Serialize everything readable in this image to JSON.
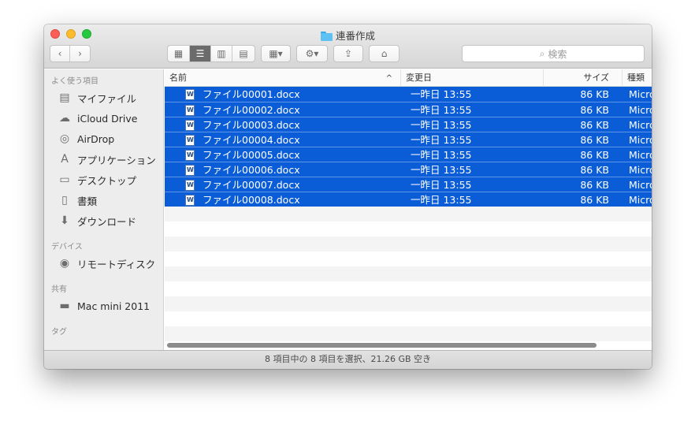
{
  "window": {
    "title": "連番作成"
  },
  "toolbar": {
    "back_icon": "‹",
    "forward_icon": "›",
    "view_icons": [
      "▦",
      "☰",
      "▥",
      "▤"
    ],
    "arrange_icon": "▦▾",
    "action_icon": "⚙▾",
    "share_icon": "⇪",
    "tag_icon": "⌂",
    "search_placeholder": "検索"
  },
  "sidebar": {
    "sections": [
      "よく使う項目",
      "デバイス",
      "共有",
      "タグ"
    ],
    "favorites": [
      {
        "label": "マイファイル",
        "icon": "all-my-files-icon"
      },
      {
        "label": "iCloud Drive",
        "icon": "cloud-icon"
      },
      {
        "label": "AirDrop",
        "icon": "airdrop-icon"
      },
      {
        "label": "アプリケーション",
        "icon": "applications-icon"
      },
      {
        "label": "デスクトップ",
        "icon": "desktop-icon"
      },
      {
        "label": "書類",
        "icon": "documents-icon"
      },
      {
        "label": "ダウンロード",
        "icon": "downloads-icon"
      }
    ],
    "devices": [
      {
        "label": "リモートディスク",
        "icon": "disc-icon"
      }
    ],
    "shared": [
      {
        "label": "Mac mini 2011",
        "icon": "computer-icon"
      }
    ]
  },
  "columns": {
    "name": "名前",
    "date": "変更日",
    "size": "サイズ",
    "kind": "種類",
    "sort_indicator": "^"
  },
  "files": [
    {
      "name": "ファイル00001.docx",
      "date": "一昨日 13:55",
      "size": "86 KB",
      "kind": "Micro"
    },
    {
      "name": "ファイル00002.docx",
      "date": "一昨日 13:55",
      "size": "86 KB",
      "kind": "Micro"
    },
    {
      "name": "ファイル00003.docx",
      "date": "一昨日 13:55",
      "size": "86 KB",
      "kind": "Micro"
    },
    {
      "name": "ファイル00004.docx",
      "date": "一昨日 13:55",
      "size": "86 KB",
      "kind": "Micro"
    },
    {
      "name": "ファイル00005.docx",
      "date": "一昨日 13:55",
      "size": "86 KB",
      "kind": "Micro"
    },
    {
      "name": "ファイル00006.docx",
      "date": "一昨日 13:55",
      "size": "86 KB",
      "kind": "Micro"
    },
    {
      "name": "ファイル00007.docx",
      "date": "一昨日 13:55",
      "size": "86 KB",
      "kind": "Micro"
    },
    {
      "name": "ファイル00008.docx",
      "date": "一昨日 13:55",
      "size": "86 KB",
      "kind": "Micro"
    }
  ],
  "status": {
    "text": "8 項目中の 8 項目を選択、21.26 GB 空き"
  },
  "colors": {
    "selection": "#0b5dd7",
    "folder": "#5ec1f3"
  }
}
